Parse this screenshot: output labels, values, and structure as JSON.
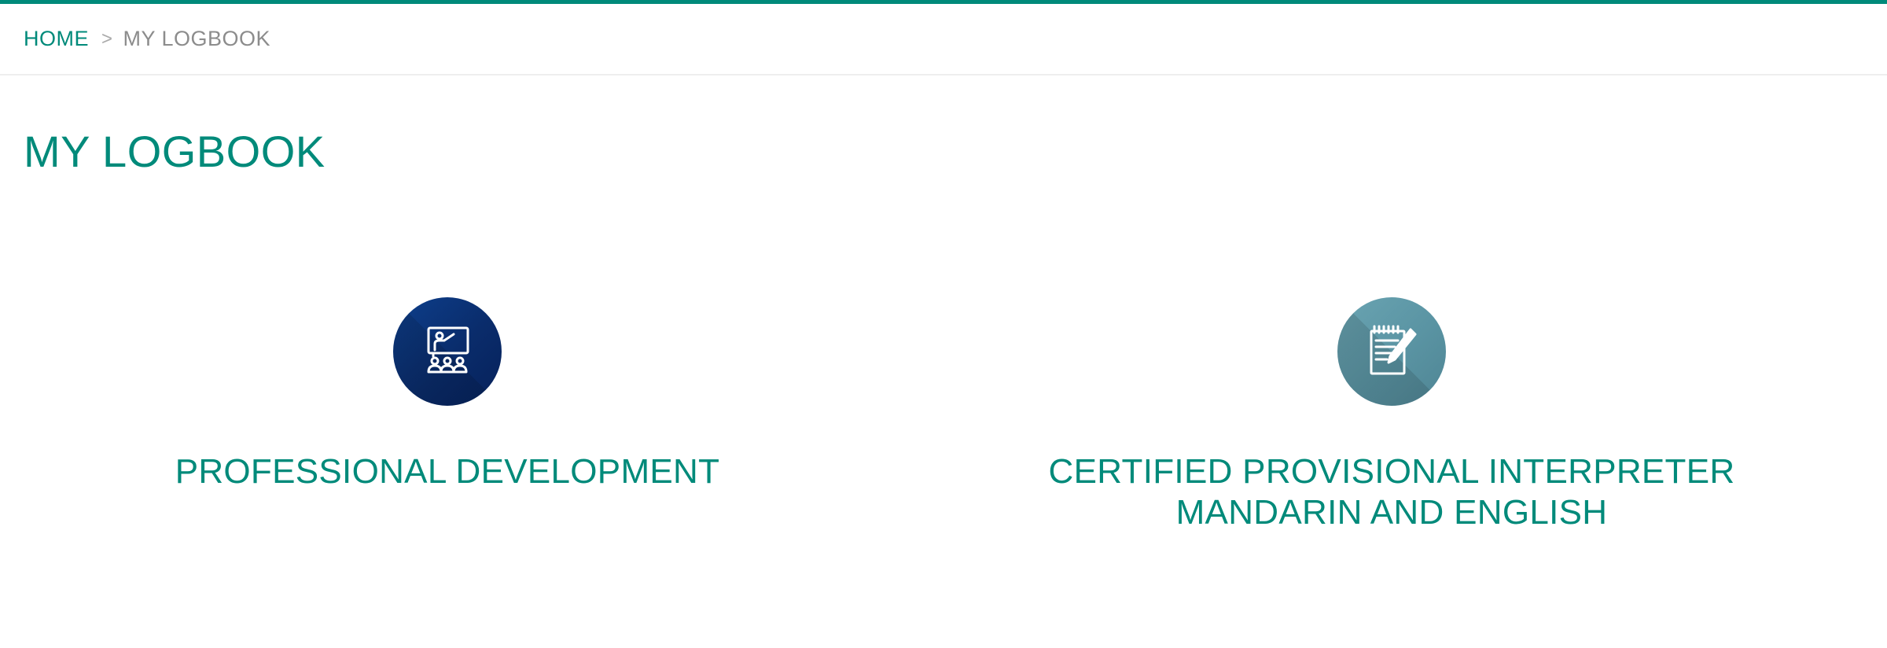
{
  "colors": {
    "accent": "#008a7a",
    "muted_text": "#8c8c8c",
    "icon_navy": "#0a2c6b",
    "icon_teal": "#5a94a3"
  },
  "breadcrumb": {
    "home_label": "HOME",
    "separator": ">",
    "current_label": "MY LOGBOOK"
  },
  "page": {
    "title": "MY LOGBOOK"
  },
  "cards": [
    {
      "icon": "presentation-classroom-icon",
      "label": "PROFESSIONAL DEVELOPMENT"
    },
    {
      "icon": "notepad-pencil-icon",
      "label_line1": "CERTIFIED PROVISIONAL INTERPRETER",
      "label_line2": "MANDARIN AND ENGLISH"
    }
  ]
}
